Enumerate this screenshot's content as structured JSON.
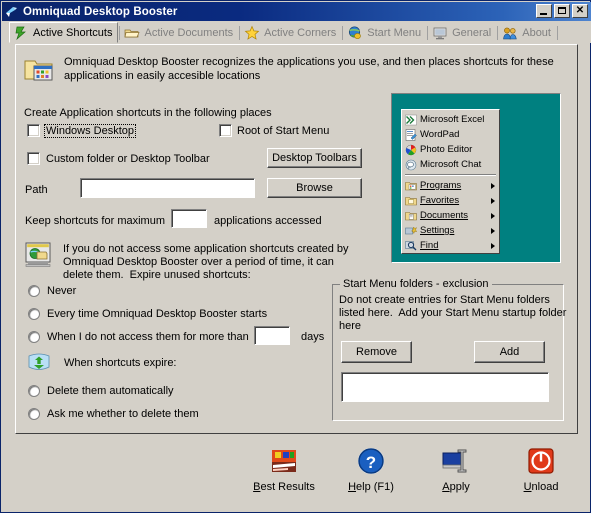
{
  "window": {
    "title": "Omniquad Desktop Booster",
    "icon": "app-logo-icon",
    "buttons": {
      "minimize": "_",
      "maximize": "□",
      "close": "✕"
    }
  },
  "tabs": [
    {
      "label": "Active Shortcuts",
      "icon": "green-arrow-icon",
      "active": true
    },
    {
      "label": "Active Documents",
      "icon": "folder-open-icon",
      "active": false
    },
    {
      "label": "Active Corners",
      "icon": "star-icon",
      "active": false
    },
    {
      "label": "Start Menu",
      "icon": "globe-icon",
      "active": false
    },
    {
      "label": "General",
      "icon": "monitor-icon",
      "active": false
    },
    {
      "label": "About",
      "icon": "people-icon",
      "active": false
    }
  ],
  "intro": {
    "icon": "folder-apps-icon",
    "line1": "Omniquad Desktop Booster recognizes the applications you use, and then places shortcuts for these",
    "line2": "applications in easily accesible locations"
  },
  "shortcuts_section": {
    "heading": "Create Application shortcuts in the following places",
    "checkboxes": [
      {
        "label": "Windows Desktop",
        "checked": false,
        "focused": true
      },
      {
        "label": "Root of Start Menu",
        "checked": false,
        "focused": false
      },
      {
        "label": "Custom folder or Desktop Toolbar",
        "checked": false,
        "focused": false
      }
    ],
    "desktop_toolbars_button": "Desktop Toolbars",
    "path_label": "Path",
    "path_value": "",
    "browse_button": "Browse",
    "keep_label": "Keep shortcuts for maximum",
    "keep_value": "",
    "keep_suffix": "applications accessed"
  },
  "expire_section": {
    "icon": "globe-folder-icon",
    "line1": "If you do not access some application shortcuts created by",
    "line2": "Omniquad Desktop Booster over a period of time, it can",
    "line3": "delete them.  Expire unused shortcuts:",
    "options": [
      {
        "label": "Never",
        "selected": false
      },
      {
        "label": "Every time Omniquad Desktop Booster starts",
        "selected": false
      },
      {
        "label": "When I do not access them for more than",
        "selected": false,
        "suffix": "days",
        "value": ""
      }
    ]
  },
  "when_expire_section": {
    "icon": "recycle-icon",
    "heading": "When shortcuts expire:",
    "options": [
      {
        "label": "Delete them automatically",
        "selected": false
      },
      {
        "label": "Ask me whether to delete them",
        "selected": false
      }
    ]
  },
  "exclusion_group": {
    "title": "Start Menu folders - exclusion",
    "desc_line1": "Do not create entries for Start Menu folders",
    "desc_line2": "listed here.  Add your Start Menu startup folder",
    "desc_line3": "here",
    "remove_button": "Remove",
    "add_button": "Add",
    "list_value": ""
  },
  "start_menu_preview": {
    "background_color": "#008080",
    "apps": [
      {
        "label": "Microsoft Excel",
        "icon": "excel-icon"
      },
      {
        "label": "WordPad",
        "icon": "wordpad-icon"
      },
      {
        "label": "Photo Editor",
        "icon": "photo-editor-icon"
      },
      {
        "label": "Microsoft Chat",
        "icon": "chat-icon"
      }
    ],
    "folders": [
      {
        "label": "Programs",
        "icon": "programs-icon",
        "submenu": true
      },
      {
        "label": "Favorites",
        "icon": "favorites-icon",
        "submenu": true
      },
      {
        "label": "Documents",
        "icon": "documents-icon",
        "submenu": true
      },
      {
        "label": "Settings",
        "icon": "settings-icon",
        "submenu": true
      },
      {
        "label": "Find",
        "icon": "find-icon",
        "submenu": true
      }
    ]
  },
  "toolbar": [
    {
      "label": "Best Results",
      "icon": "best-results-icon",
      "accel": "B"
    },
    {
      "label": "Help (F1)",
      "icon": "help-icon",
      "accel": "H"
    },
    {
      "label": "Apply",
      "icon": "apply-icon",
      "accel": "A"
    },
    {
      "label": "Unload",
      "icon": "unload-icon",
      "accel": "U"
    }
  ]
}
